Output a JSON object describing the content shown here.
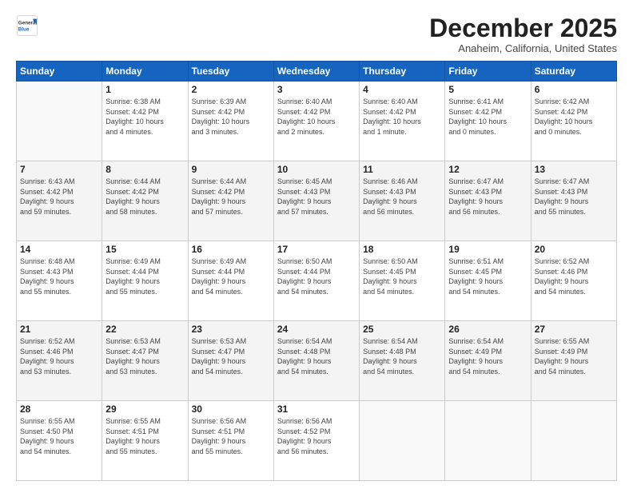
{
  "header": {
    "logo_general": "General",
    "logo_blue": "Blue",
    "month": "December 2025",
    "location": "Anaheim, California, United States"
  },
  "days_of_week": [
    "Sunday",
    "Monday",
    "Tuesday",
    "Wednesday",
    "Thursday",
    "Friday",
    "Saturday"
  ],
  "weeks": [
    [
      {
        "day": "",
        "info": ""
      },
      {
        "day": "1",
        "info": "Sunrise: 6:38 AM\nSunset: 4:42 PM\nDaylight: 10 hours\nand 4 minutes."
      },
      {
        "day": "2",
        "info": "Sunrise: 6:39 AM\nSunset: 4:42 PM\nDaylight: 10 hours\nand 3 minutes."
      },
      {
        "day": "3",
        "info": "Sunrise: 6:40 AM\nSunset: 4:42 PM\nDaylight: 10 hours\nand 2 minutes."
      },
      {
        "day": "4",
        "info": "Sunrise: 6:40 AM\nSunset: 4:42 PM\nDaylight: 10 hours\nand 1 minute."
      },
      {
        "day": "5",
        "info": "Sunrise: 6:41 AM\nSunset: 4:42 PM\nDaylight: 10 hours\nand 0 minutes."
      },
      {
        "day": "6",
        "info": "Sunrise: 6:42 AM\nSunset: 4:42 PM\nDaylight: 10 hours\nand 0 minutes."
      }
    ],
    [
      {
        "day": "7",
        "info": "Sunrise: 6:43 AM\nSunset: 4:42 PM\nDaylight: 9 hours\nand 59 minutes."
      },
      {
        "day": "8",
        "info": "Sunrise: 6:44 AM\nSunset: 4:42 PM\nDaylight: 9 hours\nand 58 minutes."
      },
      {
        "day": "9",
        "info": "Sunrise: 6:44 AM\nSunset: 4:42 PM\nDaylight: 9 hours\nand 57 minutes."
      },
      {
        "day": "10",
        "info": "Sunrise: 6:45 AM\nSunset: 4:43 PM\nDaylight: 9 hours\nand 57 minutes."
      },
      {
        "day": "11",
        "info": "Sunrise: 6:46 AM\nSunset: 4:43 PM\nDaylight: 9 hours\nand 56 minutes."
      },
      {
        "day": "12",
        "info": "Sunrise: 6:47 AM\nSunset: 4:43 PM\nDaylight: 9 hours\nand 56 minutes."
      },
      {
        "day": "13",
        "info": "Sunrise: 6:47 AM\nSunset: 4:43 PM\nDaylight: 9 hours\nand 55 minutes."
      }
    ],
    [
      {
        "day": "14",
        "info": "Sunrise: 6:48 AM\nSunset: 4:43 PM\nDaylight: 9 hours\nand 55 minutes."
      },
      {
        "day": "15",
        "info": "Sunrise: 6:49 AM\nSunset: 4:44 PM\nDaylight: 9 hours\nand 55 minutes."
      },
      {
        "day": "16",
        "info": "Sunrise: 6:49 AM\nSunset: 4:44 PM\nDaylight: 9 hours\nand 54 minutes."
      },
      {
        "day": "17",
        "info": "Sunrise: 6:50 AM\nSunset: 4:44 PM\nDaylight: 9 hours\nand 54 minutes."
      },
      {
        "day": "18",
        "info": "Sunrise: 6:50 AM\nSunset: 4:45 PM\nDaylight: 9 hours\nand 54 minutes."
      },
      {
        "day": "19",
        "info": "Sunrise: 6:51 AM\nSunset: 4:45 PM\nDaylight: 9 hours\nand 54 minutes."
      },
      {
        "day": "20",
        "info": "Sunrise: 6:52 AM\nSunset: 4:46 PM\nDaylight: 9 hours\nand 54 minutes."
      }
    ],
    [
      {
        "day": "21",
        "info": "Sunrise: 6:52 AM\nSunset: 4:46 PM\nDaylight: 9 hours\nand 53 minutes."
      },
      {
        "day": "22",
        "info": "Sunrise: 6:53 AM\nSunset: 4:47 PM\nDaylight: 9 hours\nand 53 minutes."
      },
      {
        "day": "23",
        "info": "Sunrise: 6:53 AM\nSunset: 4:47 PM\nDaylight: 9 hours\nand 54 minutes."
      },
      {
        "day": "24",
        "info": "Sunrise: 6:54 AM\nSunset: 4:48 PM\nDaylight: 9 hours\nand 54 minutes."
      },
      {
        "day": "25",
        "info": "Sunrise: 6:54 AM\nSunset: 4:48 PM\nDaylight: 9 hours\nand 54 minutes."
      },
      {
        "day": "26",
        "info": "Sunrise: 6:54 AM\nSunset: 4:49 PM\nDaylight: 9 hours\nand 54 minutes."
      },
      {
        "day": "27",
        "info": "Sunrise: 6:55 AM\nSunset: 4:49 PM\nDaylight: 9 hours\nand 54 minutes."
      }
    ],
    [
      {
        "day": "28",
        "info": "Sunrise: 6:55 AM\nSunset: 4:50 PM\nDaylight: 9 hours\nand 54 minutes."
      },
      {
        "day": "29",
        "info": "Sunrise: 6:55 AM\nSunset: 4:51 PM\nDaylight: 9 hours\nand 55 minutes."
      },
      {
        "day": "30",
        "info": "Sunrise: 6:56 AM\nSunset: 4:51 PM\nDaylight: 9 hours\nand 55 minutes."
      },
      {
        "day": "31",
        "info": "Sunrise: 6:56 AM\nSunset: 4:52 PM\nDaylight: 9 hours\nand 56 minutes."
      },
      {
        "day": "",
        "info": ""
      },
      {
        "day": "",
        "info": ""
      },
      {
        "day": "",
        "info": ""
      }
    ]
  ]
}
